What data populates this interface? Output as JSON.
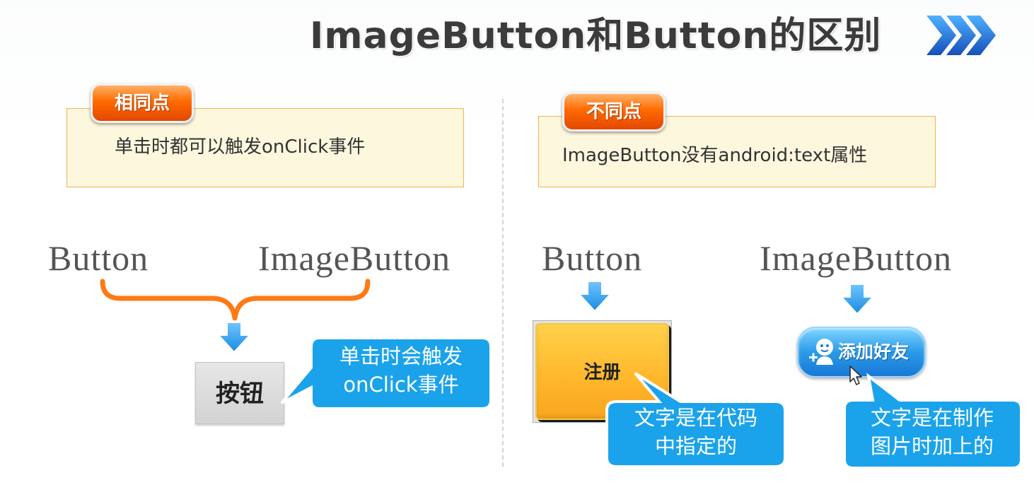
{
  "title": "ImageButton和Button的区别",
  "left_panel": {
    "tag": "相同点",
    "description": "单击时都可以触发onClick事件",
    "label_button": "Button",
    "label_imagebutton": "ImageButton",
    "sample_button": "按钮",
    "callout_line1": "单击时会触发",
    "callout_line2": "onClick事件"
  },
  "right_panel": {
    "tag": "不同点",
    "description": "ImageButton没有android:text属性",
    "label_button": "Button",
    "label_imagebutton": "ImageButton",
    "register_button": "注册",
    "add_friend_button": "添加好友",
    "callout_button_line1": "文字是在代码",
    "callout_button_line2": "中指定的",
    "callout_image_line1": "文字是在制作",
    "callout_image_line2": "图片时加上的"
  },
  "colors": {
    "accent_orange": "#ff6a00",
    "callout_blue": "#1aa3ea",
    "arrow_blue": "#2aa0ea",
    "brace_orange": "#ff7a16",
    "box_fill": "#fdf7de",
    "box_border": "#f3b251"
  }
}
